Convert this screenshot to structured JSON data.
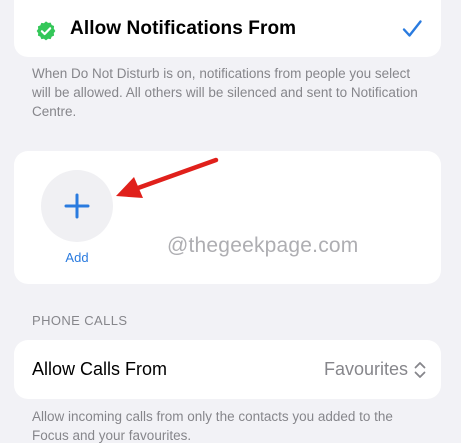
{
  "focus_people": {
    "allow_notifications_label": "Allow Notifications From",
    "description": "When Do Not Disturb is on, notifications from people you select will be allowed. All others will be silenced and sent to Notification Centre.",
    "add_label": "Add"
  },
  "watermark": "@thegeekpage.com",
  "phone_calls": {
    "section_header": "PHONE CALLS",
    "allow_calls_label": "Allow Calls From",
    "allow_calls_value": "Favourites",
    "description": "Allow incoming calls from only the contacts you added to the Focus and your favourites."
  },
  "colors": {
    "accent_blue": "#2a7bdf",
    "badge_green": "#34c759",
    "annotation_red": "#e0201b",
    "background": "#f2f2f6"
  },
  "icons": {
    "badge": "verified-badge-icon",
    "check": "checkmark-icon",
    "add": "plus-icon",
    "chevrons": "chevron-up-down-icon"
  }
}
